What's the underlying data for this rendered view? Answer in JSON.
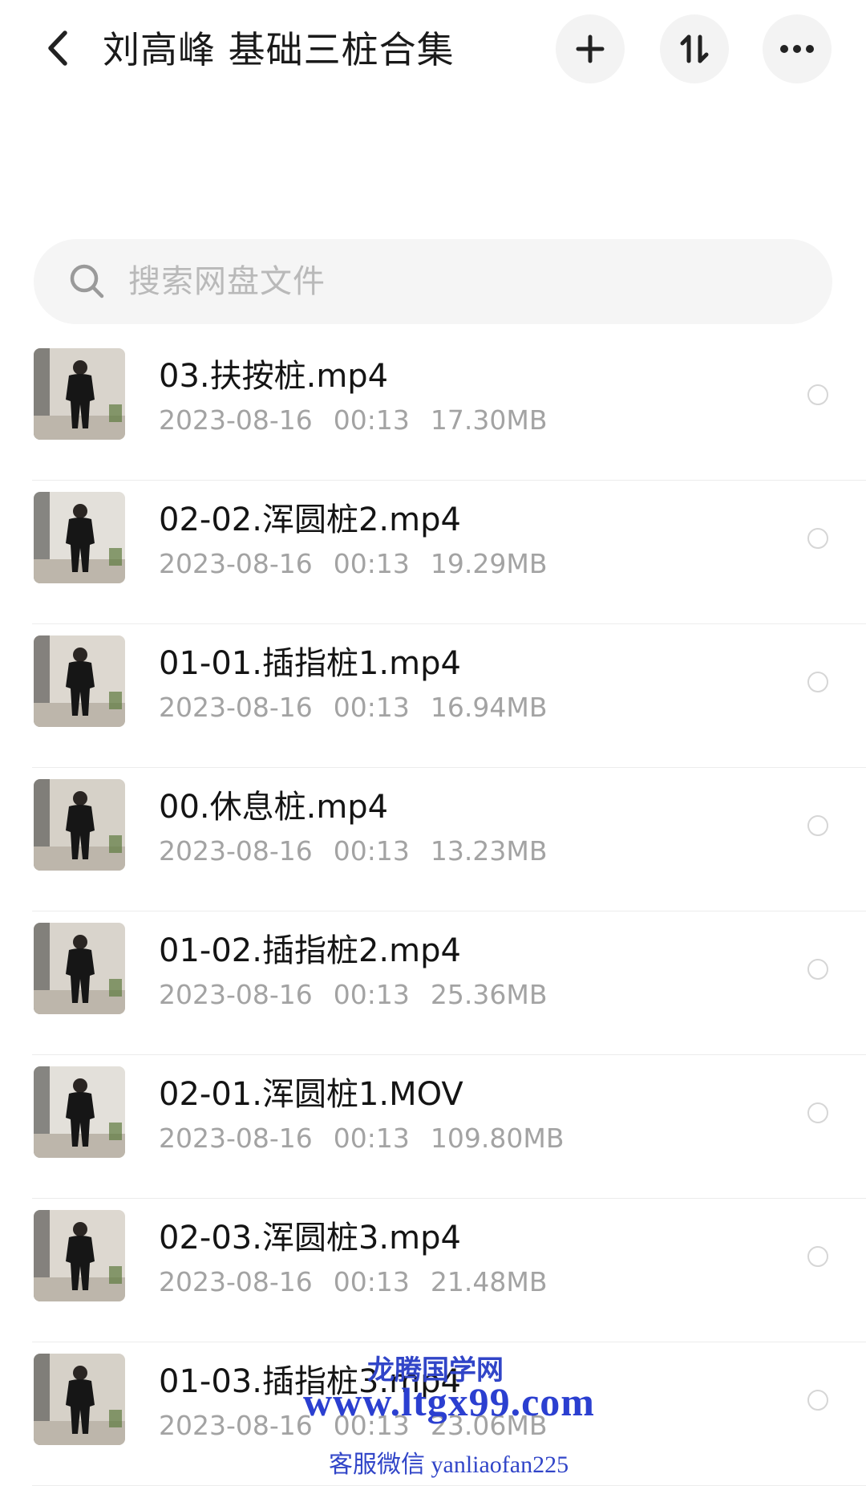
{
  "header": {
    "title": "刘高峰 基础三桩合集",
    "back_icon": "chevron-left-icon",
    "actions": [
      {
        "name": "add",
        "icon": "plus-icon"
      },
      {
        "name": "sort",
        "icon": "sort-arrows-icon"
      },
      {
        "name": "more",
        "icon": "more-dots-icon"
      }
    ]
  },
  "search": {
    "placeholder": "搜索网盘文件",
    "icon": "search-icon"
  },
  "files": [
    {
      "name": "03.扶按桩.mp4",
      "date": "2023-08-16",
      "time": "00:13",
      "size": "17.30MB"
    },
    {
      "name": "02-02.浑圆桩2.mp4",
      "date": "2023-08-16",
      "time": "00:13",
      "size": "19.29MB"
    },
    {
      "name": "01-01.插指桩1.mp4",
      "date": "2023-08-16",
      "time": "00:13",
      "size": "16.94MB"
    },
    {
      "name": "00.休息桩.mp4",
      "date": "2023-08-16",
      "time": "00:13",
      "size": "13.23MB"
    },
    {
      "name": "01-02.插指桩2.mp4",
      "date": "2023-08-16",
      "time": "00:13",
      "size": "25.36MB"
    },
    {
      "name": "02-01.浑圆桩1.MOV",
      "date": "2023-08-16",
      "time": "00:13",
      "size": "109.80MB"
    },
    {
      "name": "02-03.浑圆桩3.mp4",
      "date": "2023-08-16",
      "time": "00:13",
      "size": "21.48MB"
    },
    {
      "name": "01-03.插指桩3.mp4",
      "date": "2023-08-16",
      "time": "00:13",
      "size": "23.06MB"
    }
  ],
  "watermark": {
    "line1": "龙腾国学网",
    "line2": "www.ltgx99.com",
    "line3": "客服微信 yanliaofan225"
  },
  "colors": {
    "title": "#1a1a1a",
    "meta": "#a3a3a3",
    "watermark": "#2b3fd0",
    "button_bg": "#f3f3f3"
  }
}
